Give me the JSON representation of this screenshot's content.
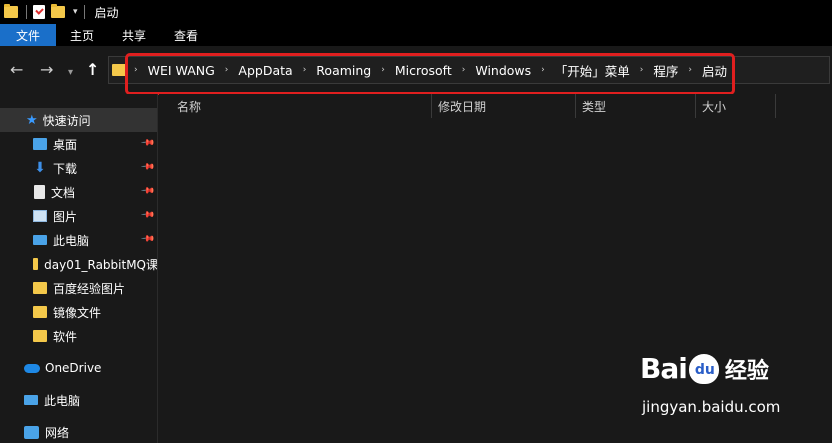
{
  "window": {
    "title": "启动"
  },
  "ribbon": {
    "tabs": [
      "文件",
      "主页",
      "共享",
      "查看"
    ]
  },
  "address": {
    "crumbs": [
      "WEI WANG",
      "AppData",
      "Roaming",
      "Microsoft",
      "Windows",
      "「开始」菜单",
      "程序",
      "启动"
    ]
  },
  "columns": [
    "名称",
    "修改日期",
    "类型",
    "大小"
  ],
  "sidebar": {
    "quick_access": "快速访问",
    "items": [
      {
        "label": "桌面",
        "icon": "desktop-icon",
        "pinned": true
      },
      {
        "label": "下载",
        "icon": "download-icon",
        "pinned": true
      },
      {
        "label": "文档",
        "icon": "document-icon",
        "pinned": true
      },
      {
        "label": "图片",
        "icon": "picture-icon",
        "pinned": true
      },
      {
        "label": "此电脑",
        "icon": "computer-icon",
        "pinned": true
      },
      {
        "label": "day01_RabbitMQ课",
        "icon": "folder-icon",
        "pinned": false
      },
      {
        "label": "百度经验图片",
        "icon": "folder-icon",
        "pinned": false
      },
      {
        "label": "镜像文件",
        "icon": "folder-icon",
        "pinned": false
      },
      {
        "label": "软件",
        "icon": "folder-icon",
        "pinned": false
      }
    ],
    "onedrive": "OneDrive",
    "this_pc": "此电脑",
    "network": "网络"
  },
  "watermark": {
    "logo_left": "Bai",
    "logo_paw": "du",
    "logo_right": "经验",
    "url": "jingyan.baidu.com"
  },
  "colors": {
    "accent": "#1a6fc9",
    "highlight_box": "#e01f1f",
    "folder": "#f4c84a"
  }
}
